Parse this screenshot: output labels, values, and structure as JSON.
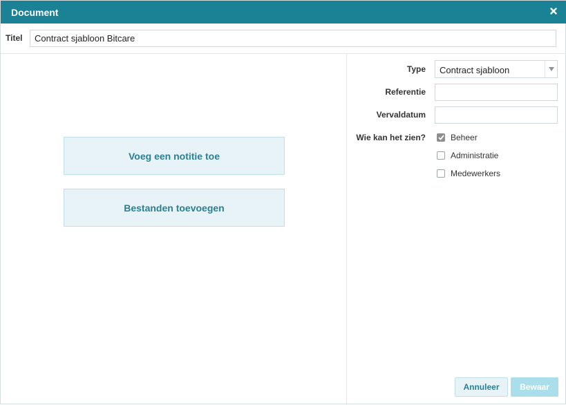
{
  "dialog": {
    "title": "Document",
    "close_icon": "close-icon"
  },
  "titel": {
    "label": "Titel",
    "value": "Contract sjabloon Bitcare"
  },
  "actions": {
    "add_note": "Voeg een notitie toe",
    "add_files": "Bestanden toevoegen"
  },
  "form": {
    "type_label": "Type",
    "type_value": "Contract sjabloon",
    "referentie_label": "Referentie",
    "referentie_value": "",
    "vervaldatum_label": "Vervaldatum",
    "vervaldatum_value": "",
    "visibility_label": "Wie kan het zien?",
    "visibility_options": [
      {
        "label": "Beheer",
        "checked": true
      },
      {
        "label": "Administratie",
        "checked": false
      },
      {
        "label": "Medewerkers",
        "checked": false
      }
    ]
  },
  "buttons": {
    "cancel": "Annuleer",
    "save": "Bewaar"
  },
  "colors": {
    "header": "#1a8294",
    "accent_text": "#2a7f93",
    "action_bg": "#e7f3f7",
    "save_disabled": "#a9deea"
  }
}
